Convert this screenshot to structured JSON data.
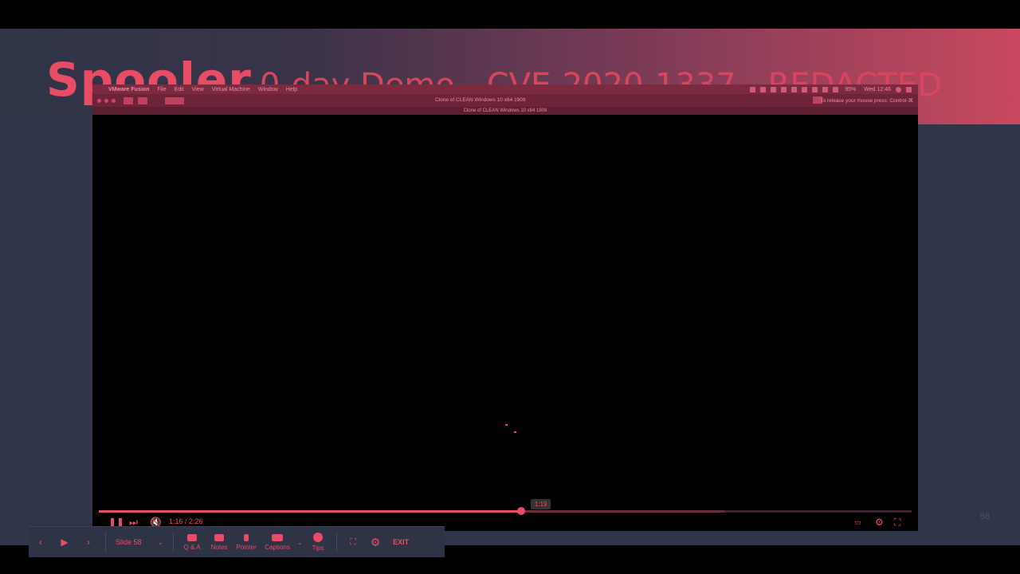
{
  "slide": {
    "title_strong": "Spooler",
    "title_rest": "0-day Demo - CVE-2020-1337 - REDACTED",
    "page_number": "58"
  },
  "mac_menubar": {
    "apple": "",
    "app": "VMware Fusion",
    "menus": [
      "File",
      "Edit",
      "View",
      "Virtual Machine",
      "Window",
      "Help"
    ],
    "battery": "95%",
    "clock": "Wed 12:46"
  },
  "vm": {
    "window_title": "Clone of CLEAN Windows 10 x64 1909",
    "release_hint": "To release your mouse press: Control-⌘",
    "subtitle": "Clone of CLEAN Windows 10 x64 1909"
  },
  "player": {
    "current_time": "1:16 / 2:26",
    "hover_time": "1:19",
    "played_fraction": 0.52,
    "loaded_fraction": 0.77,
    "hover_fraction": 0.545
  },
  "pres_toolbar": {
    "slide_label": "Slide 58",
    "qa": "Q & A",
    "notes": "Notes",
    "pointer": "Pointer",
    "captions": "Captions",
    "tips": "Tips",
    "exit": "EXIT"
  },
  "colors": {
    "accent": "#e84d65",
    "slide_bg": "#2f3447"
  }
}
